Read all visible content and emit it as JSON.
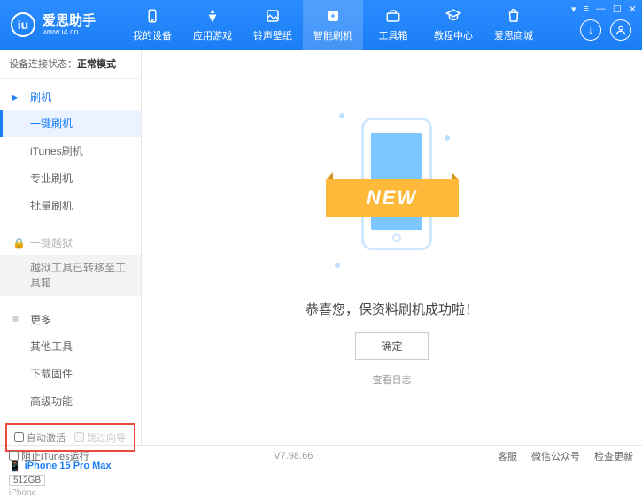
{
  "app": {
    "name": "爱思助手",
    "url": "www.i4.cn"
  },
  "nav": {
    "items": [
      {
        "label": "我的设备"
      },
      {
        "label": "应用游戏"
      },
      {
        "label": "铃声壁纸"
      },
      {
        "label": "智能刷机"
      },
      {
        "label": "工具箱"
      },
      {
        "label": "教程中心"
      },
      {
        "label": "爱思商城"
      }
    ],
    "active_index": 3
  },
  "status": {
    "label": "设备连接状态：",
    "value": "正常模式"
  },
  "sidebar": {
    "section_flash": {
      "title": "刷机",
      "items": [
        "一键刷机",
        "iTunes刷机",
        "专业刷机",
        "批量刷机"
      ],
      "active_index": 0
    },
    "section_jailbreak": {
      "title": "一键越狱",
      "note": "越狱工具已转移至工具箱"
    },
    "section_more": {
      "title": "更多",
      "items": [
        "其他工具",
        "下载固件",
        "高级功能"
      ]
    }
  },
  "checkboxes": {
    "auto_activate": "自动激活",
    "skip_setup": "跳过向导"
  },
  "device": {
    "name": "iPhone 15 Pro Max",
    "storage": "512GB",
    "type": "iPhone"
  },
  "main": {
    "ribbon": "NEW",
    "success": "恭喜您，保资料刷机成功啦！",
    "ok": "确定",
    "log": "查看日志"
  },
  "footer": {
    "block_itunes": "阻止iTunes运行",
    "version": "V7.98.66",
    "links": [
      "客服",
      "微信公众号",
      "检查更新"
    ]
  }
}
